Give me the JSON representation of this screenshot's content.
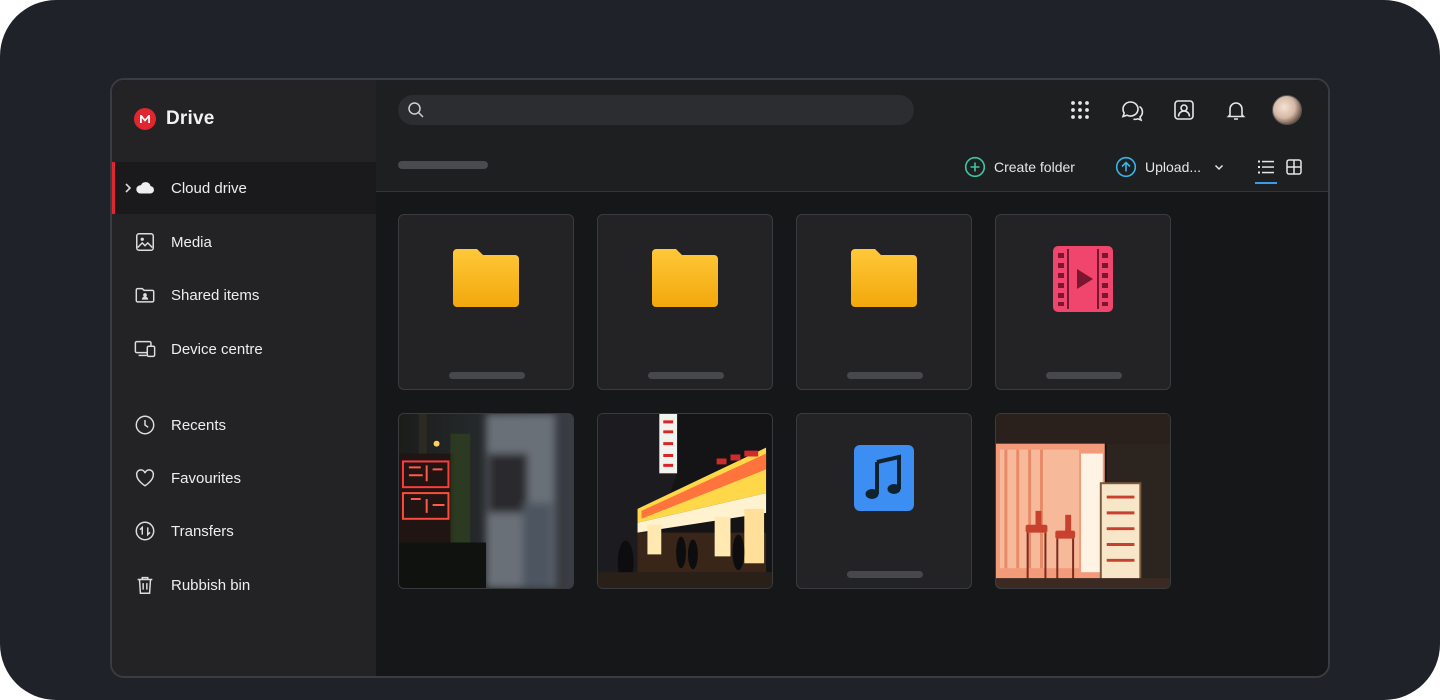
{
  "app": {
    "name": "Drive",
    "logo_letter": "M",
    "brand_color": "#e0262f"
  },
  "sidebar": {
    "items": [
      {
        "label": "Cloud drive",
        "icon": "cloud-icon",
        "active": true
      },
      {
        "label": "Media",
        "icon": "image-icon"
      },
      {
        "label": "Shared items",
        "icon": "shared-folder-icon"
      },
      {
        "label": "Device centre",
        "icon": "devices-icon"
      },
      {
        "label": "Recents",
        "icon": "clock-icon"
      },
      {
        "label": "Favourites",
        "icon": "heart-icon"
      },
      {
        "label": "Transfers",
        "icon": "transfers-icon"
      },
      {
        "label": "Rubbish bin",
        "icon": "trash-icon"
      }
    ]
  },
  "header": {
    "search_placeholder": "",
    "icons": [
      "apps-grid-icon",
      "chat-icon",
      "contacts-icon",
      "bell-icon",
      "avatar"
    ]
  },
  "toolbar": {
    "create_folder_label": "Create folder",
    "upload_label": "Upload...",
    "view_modes": [
      "list-view-icon",
      "grid-view-icon"
    ],
    "selected_view": "list"
  },
  "files": [
    {
      "type": "folder",
      "icon": "folder-icon"
    },
    {
      "type": "folder",
      "icon": "folder-icon"
    },
    {
      "type": "folder",
      "icon": "folder-icon"
    },
    {
      "type": "video",
      "icon": "video-file-icon"
    },
    {
      "type": "image",
      "thumb": "neon-street-photo"
    },
    {
      "type": "image",
      "thumb": "night-market-photo"
    },
    {
      "type": "audio",
      "icon": "music-file-icon"
    },
    {
      "type": "image",
      "thumb": "bar-interior-photo"
    }
  ],
  "colors": {
    "folder": "#f7b51a",
    "video": "#f0466e",
    "audio": "#3d8ef2",
    "create_folder_accent": "#3cc5a4",
    "upload_accent": "#36b5e6"
  }
}
